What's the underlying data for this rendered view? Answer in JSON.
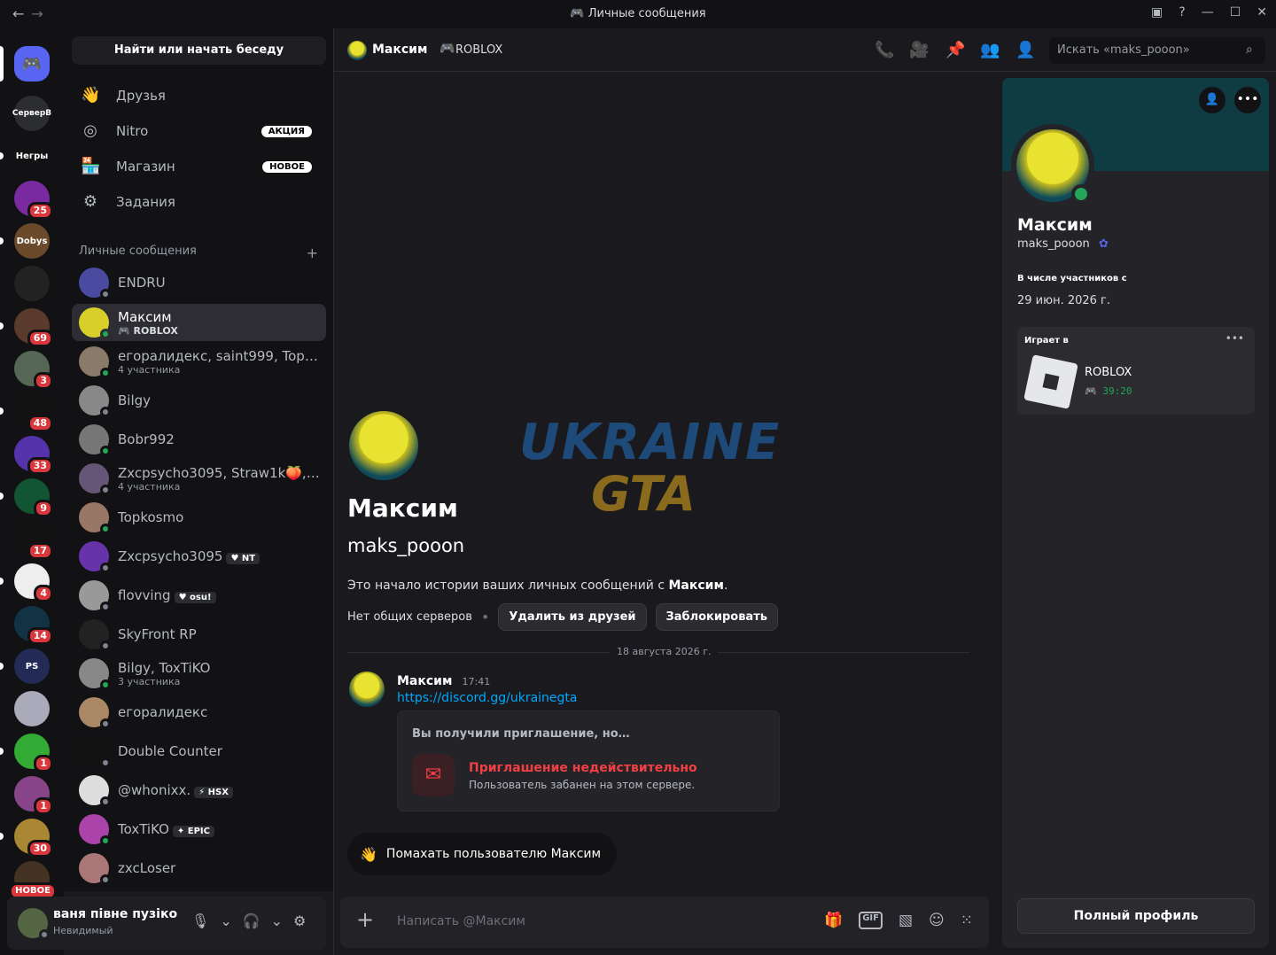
{
  "window": {
    "title": "Личные сообщения"
  },
  "find_bar": {
    "label": "Найти или начать беседу"
  },
  "nav": [
    {
      "label": "Друзья",
      "icon": "friends-icon",
      "badge": ""
    },
    {
      "label": "Nitro",
      "icon": "nitro-icon",
      "badge": "АКЦИЯ"
    },
    {
      "label": "Магазин",
      "icon": "shop-icon",
      "badge": "НОВОЕ"
    },
    {
      "label": "Задания",
      "icon": "quests-icon",
      "badge": ""
    }
  ],
  "dm_section": {
    "title": "Личные сообщения",
    "add": "+"
  },
  "dms": [
    {
      "name": "ENDRU",
      "sub": "",
      "tag": "",
      "color": "#4a4aa0",
      "status": "#80848e"
    },
    {
      "name": "Максим",
      "sub": "ROBLOX",
      "tag": "",
      "color": "#d8cf2a",
      "status": "#23a55a",
      "selected": true
    },
    {
      "name": "егоралидекс, saint999, Topkos…",
      "sub": "4 участника",
      "tag": "",
      "color": "#8a7a6a",
      "status": "#23a55a"
    },
    {
      "name": "Bilgy",
      "sub": "",
      "tag": "",
      "color": "#888",
      "status": "#80848e"
    },
    {
      "name": "Bobr992",
      "sub": "",
      "tag": "",
      "color": "#777",
      "status": "#23a55a"
    },
    {
      "name": "Zxcpsycho3095, Straw1k🍑, Ka…",
      "sub": "4 участника",
      "tag": "",
      "color": "#665577",
      "status": "#80848e"
    },
    {
      "name": "Topkosmo",
      "sub": "",
      "tag": "",
      "color": "#997766",
      "status": "#23a55a"
    },
    {
      "name": "Zxcpsycho3095",
      "sub": "",
      "tag": "♥ NT",
      "color": "#6633aa",
      "status": "#80848e"
    },
    {
      "name": "flovving",
      "sub": "",
      "tag": "♥ osu!",
      "color": "#999",
      "status": "#80848e"
    },
    {
      "name": "SkyFront RP",
      "sub": "",
      "tag": "",
      "color": "#222",
      "status": "#80848e"
    },
    {
      "name": "Bilgy, ToxTiKO",
      "sub": "3 участника",
      "tag": "",
      "color": "#888",
      "status": "#23a55a"
    },
    {
      "name": "егоралидекс",
      "sub": "",
      "tag": "",
      "color": "#aa8866",
      "status": "#80848e"
    },
    {
      "name": "Double Counter",
      "sub": "",
      "tag": "",
      "color": "#111",
      "status": "#80848e"
    },
    {
      "name": "@whonixx.",
      "sub": "",
      "tag": "⚡ HSX",
      "color": "#ddd",
      "status": "#80848e"
    },
    {
      "name": "ToxTiKO",
      "sub": "",
      "tag": "✦ EPIC",
      "color": "#aa44aa",
      "status": "#23a55a"
    },
    {
      "name": "zxcLoser",
      "sub": "",
      "tag": "",
      "color": "#aa7777",
      "status": "#80848e"
    }
  ],
  "servers": [
    {
      "label": "",
      "badge": "",
      "color": "#5865f2",
      "icon": "discord-logo-icon"
    },
    {
      "label": "СерверВ",
      "badge": "",
      "color": "#2b2d31"
    },
    {
      "label": "Негры",
      "badge": "",
      "color": "#121214"
    },
    {
      "label": "",
      "badge": "25",
      "color": "#7a2aa0"
    },
    {
      "label": "Dobys",
      "badge": "",
      "color": "#6a4a2a"
    },
    {
      "label": "",
      "badge": "",
      "color": "#222"
    },
    {
      "label": "",
      "badge": "69",
      "color": "#5a3a2a"
    },
    {
      "label": "",
      "badge": "3",
      "color": "#556655"
    },
    {
      "label": "",
      "badge": "48",
      "color": "#111"
    },
    {
      "label": "",
      "badge": "33",
      "color": "#5533aa"
    },
    {
      "label": "",
      "badge": "9",
      "color": "#115533"
    },
    {
      "label": "",
      "badge": "17",
      "color": "#111"
    },
    {
      "label": "",
      "badge": "4",
      "color": "#eee"
    },
    {
      "label": "",
      "badge": "14",
      "color": "#113344"
    },
    {
      "label": "PS",
      "badge": "",
      "color": "#222a55"
    },
    {
      "label": "",
      "badge": "",
      "color": "#aab"
    },
    {
      "label": "",
      "badge": "1",
      "color": "#33aa33"
    },
    {
      "label": "",
      "badge": "1",
      "color": "#884488"
    },
    {
      "label": "",
      "badge": "30",
      "color": "#aa8833"
    },
    {
      "label": "",
      "badge": "НОВОЕ",
      "color": "#443322"
    }
  ],
  "user_panel": {
    "name": "ваня півне пузіко",
    "status": "Невидимый"
  },
  "chat_header": {
    "name": "Максим",
    "activity": "ROBLOX",
    "search_placeholder": "Искать «maks_pooon»"
  },
  "intro": {
    "display_name": "Максим",
    "username": "maks_pooon",
    "text_prefix": "Это начало истории ваших личных сообщений с ",
    "text_name": "Максим",
    "text_suffix": ".",
    "mutual": "Нет общих серверов",
    "remove_friend": "Удалить из друзей",
    "block": "Заблокировать"
  },
  "watermark": {
    "line1": "UKRAINE",
    "line2": "GTA"
  },
  "divider_date": "18 августа 2026 г.",
  "message": {
    "author": "Максим",
    "time": "17:41",
    "link": "https://discord.gg/ukrainegta",
    "invite_title": "Вы получили приглашение, но…",
    "invite_invalid": "Приглашение недействительно",
    "invite_reason": "Пользователь забанен на этом сервере."
  },
  "wave_button": "Помахать пользователю Максим",
  "composer": {
    "placeholder": "Написать @Максим"
  },
  "profile": {
    "display_name": "Максим",
    "username": "maks_pooon",
    "member_since_label": "В числе участников с",
    "member_since": "29 июн. 2026 г.",
    "playing_label": "Играет в",
    "game": "ROBLOX",
    "game_time": "39:20",
    "full_profile": "Полный профиль"
  },
  "colors": {
    "accent": "#5865f2",
    "online": "#23a55a",
    "danger": "#f23f43",
    "link": "#00a8fc"
  }
}
